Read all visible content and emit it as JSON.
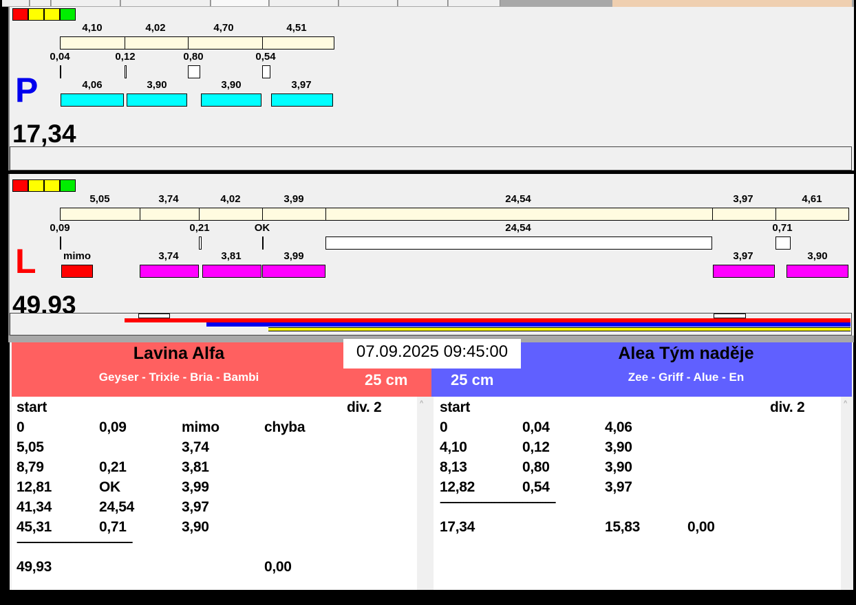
{
  "colors": {
    "red": "#ff0000",
    "yellow": "#ffff00",
    "green": "#00ee00",
    "cyan": "#00ffff",
    "magenta": "#ff00ff",
    "left_team": "#ff6060",
    "right_team": "#6060ff"
  },
  "lane_p": {
    "letter": "P",
    "segment_labels": [
      "4,10",
      "4,02",
      "4,70",
      "4,51"
    ],
    "gap_labels": [
      "0,04",
      "0,12",
      "0,80",
      "0,54"
    ],
    "run_labels": [
      "4,06",
      "3,90",
      "3,90",
      "3,97"
    ],
    "total": "17,34"
  },
  "lane_l": {
    "letter": "L",
    "segment_labels": [
      "5,05",
      "3,74",
      "4,02",
      "3,99",
      "24,54",
      "3,97",
      "4,61"
    ],
    "gap_labels": [
      "0,09",
      "0,21",
      "OK",
      "24,54",
      "0,71"
    ],
    "run_labels": [
      "mimo",
      "3,74",
      "3,81",
      "3,99",
      "3,97",
      "3,90"
    ],
    "total": "49,93"
  },
  "datetime": "07.09.2025 09:45:00",
  "left_team": {
    "name": "Lavina Alfa",
    "members": "Geyser - Trixie - Bria - Bambi",
    "height": "25 cm"
  },
  "right_team": {
    "name": "Alea Tým naděje",
    "members": "Zee - Griff - Alue - En",
    "height": "25 cm"
  },
  "left_list": {
    "header": "start",
    "division": "div.  2",
    "rows": [
      [
        "0",
        "0,09",
        "mimo",
        "chyba"
      ],
      [
        "5,05",
        "",
        "3,74",
        ""
      ],
      [
        "8,79",
        "0,21",
        "3,81",
        ""
      ],
      [
        "12,81",
        "OK",
        "3,99",
        ""
      ],
      [
        "41,34",
        "24,54",
        "3,97",
        ""
      ],
      [
        "45,31",
        "0,71",
        "3,90",
        ""
      ]
    ],
    "separator": "---------------------------------------------",
    "footer": [
      "49,93",
      "",
      "",
      "0,00"
    ]
  },
  "right_list": {
    "header": "start",
    "division": "div.  2",
    "rows": [
      [
        "0",
        "0,04",
        "4,06",
        ""
      ],
      [
        "4,10",
        "0,12",
        "3,90",
        ""
      ],
      [
        "8,13",
        "0,80",
        "3,90",
        ""
      ],
      [
        "12,82",
        "0,54",
        "3,97",
        ""
      ]
    ],
    "separator": "---------------------------------------------",
    "footer": [
      "17,34",
      "",
      "15,83",
      "0,00"
    ]
  }
}
